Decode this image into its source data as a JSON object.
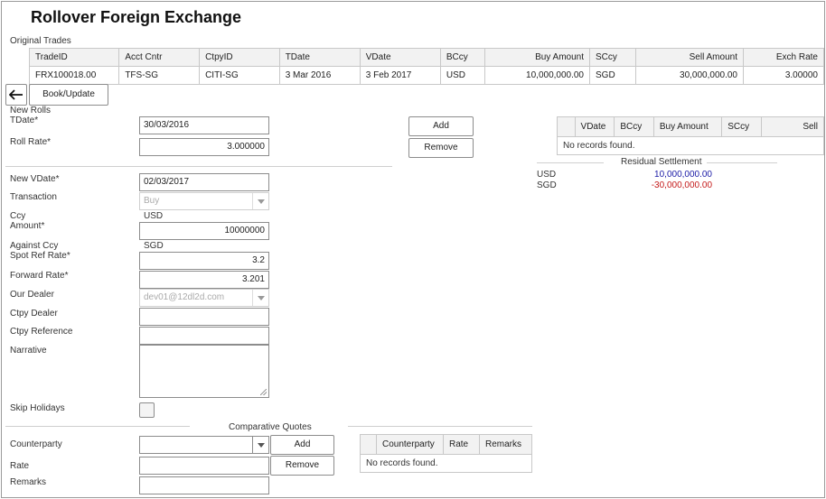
{
  "page": {
    "title": "Rollover Foreign Exchange"
  },
  "original_trades": {
    "section_label": "Original Trades",
    "columns": [
      "TradeID",
      "Acct Cntr",
      "CtpyID",
      "TDate",
      "VDate",
      "BCcy",
      "Buy Amount",
      "SCcy",
      "Sell Amount",
      "Exch Rate"
    ],
    "rows": [
      [
        "FRX100018.00",
        "TFS-SG",
        "CITI-SG",
        "3 Mar 2016",
        "3 Feb 2017",
        "USD",
        "10,000,000.00",
        "SGD",
        "30,000,000.00",
        "3.00000"
      ]
    ]
  },
  "toolbar": {
    "back_icon": "arrow-left-icon",
    "book_update_label": "Book/Update"
  },
  "new_rolls": {
    "section_label": "New Rolls",
    "tdate_label": "TDate*",
    "tdate_value": "30/03/2016",
    "roll_rate_label": "Roll Rate*",
    "roll_rate_value": "3.000000",
    "add_label": "Add",
    "remove_label": "Remove"
  },
  "rolls_table": {
    "columns": [
      "",
      "VDate",
      "BCcy",
      "Buy Amount",
      "SCcy",
      "Sell"
    ],
    "empty_text": "No records found."
  },
  "residual": {
    "title": "Residual Settlement",
    "rows": [
      {
        "ccy": "USD",
        "amount": "10,000,000.00",
        "color": "#1a1aa6"
      },
      {
        "ccy": "SGD",
        "amount": "-30,000,000.00",
        "color": "#c41a1a"
      }
    ]
  },
  "form": {
    "new_vdate_label": "New VDate*",
    "new_vdate_value": "02/03/2017",
    "transaction_label": "Transaction",
    "transaction_value": "Buy",
    "ccy_label": "Ccy",
    "ccy_value": "USD",
    "amount_label": "Amount*",
    "amount_value": "10000000",
    "against_ccy_label": "Against Ccy",
    "against_ccy_value": "SGD",
    "spot_ref_label": "Spot Ref Rate*",
    "spot_ref_value": "3.2",
    "forward_rate_label": "Forward Rate*",
    "forward_rate_value": "3.201",
    "our_dealer_label": "Our Dealer",
    "our_dealer_value": "dev01@12dl2d.com",
    "ctpy_dealer_label": "Ctpy Dealer",
    "ctpy_dealer_value": "",
    "ctpy_reference_label": "Ctpy Reference",
    "ctpy_reference_value": "",
    "narrative_label": "Narrative",
    "skip_holidays_label": "Skip Holidays"
  },
  "quotes": {
    "title": "Comparative Quotes",
    "counterparty_label": "Counterparty",
    "rate_label": "Rate",
    "remarks_label": "Remarks",
    "add_label": "Add",
    "remove_label": "Remove",
    "columns": [
      "",
      "Counterparty",
      "Rate",
      "Remarks"
    ],
    "empty_text": "No records found."
  }
}
